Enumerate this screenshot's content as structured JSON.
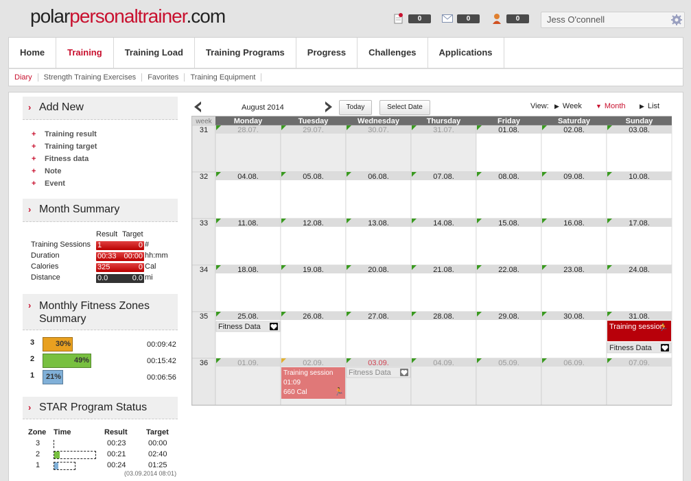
{
  "logo": {
    "part1": "polar",
    "part2": "personaltrainer",
    "part3": ".com"
  },
  "header": {
    "notifications": "0",
    "messages": "0",
    "friends": "0",
    "user": "Jess O'connell"
  },
  "nav": {
    "tabs": [
      "Home",
      "Training",
      "Training Load",
      "Training Programs",
      "Progress",
      "Challenges",
      "Applications"
    ],
    "active": 1
  },
  "subnav": {
    "items": [
      "Diary",
      "Strength Training Exercises",
      "Favorites",
      "Training Equipment"
    ],
    "active": 0
  },
  "add_new": {
    "title": "Add New",
    "items": [
      "Training result",
      "Training target",
      "Fitness data",
      "Note",
      "Event"
    ]
  },
  "month_summary": {
    "title": "Month Summary",
    "col_result": "Result",
    "col_target": "Target",
    "rows": [
      {
        "label": "Training Sessions",
        "result": "1",
        "target": "0",
        "unit": "#",
        "color": "red"
      },
      {
        "label": "Duration",
        "result": "00:33",
        "target": "00:00",
        "unit": "hh:mm",
        "color": "red"
      },
      {
        "label": "Calories",
        "result": "325",
        "target": "0",
        "unit": "Cal",
        "color": "red"
      },
      {
        "label": "Distance",
        "result": "0.0",
        "target": "0.0",
        "unit": "mi",
        "color": "dark"
      }
    ]
  },
  "zones": {
    "title_line1": "Monthly Fitness Zones",
    "title_line2": "Summary",
    "rows": [
      {
        "zone": "3",
        "pct": "30%",
        "pct_value": 30,
        "time": "00:09:42",
        "color": "#e8a020"
      },
      {
        "zone": "2",
        "pct": "49%",
        "pct_value": 49,
        "time": "00:15:42",
        "color": "#78c040"
      },
      {
        "zone": "1",
        "pct": "21%",
        "pct_value": 21,
        "time": "00:06:56",
        "color": "#80b0d8"
      }
    ]
  },
  "star": {
    "title": "STAR Program Status",
    "col_zone": "Zone",
    "col_time": "Time",
    "col_result": "Result",
    "col_target": "Target",
    "rows": [
      {
        "zone": "3",
        "result": "00:23",
        "target": "00:00"
      },
      {
        "zone": "2",
        "result": "00:21",
        "target": "02:40"
      },
      {
        "zone": "1",
        "result": "00:24",
        "target": "01:25"
      }
    ],
    "timestamp": "(03.09.2014 08:01)"
  },
  "calendar": {
    "month_label": "August 2014",
    "today_btn": "Today",
    "select_date_btn": "Select Date",
    "view_label": "View:",
    "views": [
      "Week",
      "Month",
      "List"
    ],
    "active_view": 1,
    "week_header": "week",
    "days": [
      "Monday",
      "Tuesday",
      "Wednesday",
      "Thursday",
      "Friday",
      "Saturday",
      "Sunday"
    ],
    "weeks": [
      {
        "num": "31",
        "dates": [
          "28.07.",
          "29.07.",
          "30.07.",
          "31.07.",
          "01.08.",
          "02.08.",
          "03.08."
        ],
        "out": [
          true,
          true,
          true,
          true,
          false,
          false,
          false
        ]
      },
      {
        "num": "32",
        "dates": [
          "04.08.",
          "05.08.",
          "06.08.",
          "07.08.",
          "08.08.",
          "09.08.",
          "10.08."
        ],
        "out": [
          false,
          false,
          false,
          false,
          false,
          false,
          false
        ]
      },
      {
        "num": "33",
        "dates": [
          "11.08.",
          "12.08.",
          "13.08.",
          "14.08.",
          "15.08.",
          "16.08.",
          "17.08."
        ],
        "out": [
          false,
          false,
          false,
          false,
          false,
          false,
          false
        ]
      },
      {
        "num": "34",
        "dates": [
          "18.08.",
          "19.08.",
          "20.08.",
          "21.08.",
          "22.08.",
          "23.08.",
          "24.08."
        ],
        "out": [
          false,
          false,
          false,
          false,
          false,
          false,
          false
        ]
      },
      {
        "num": "35",
        "dates": [
          "25.08.",
          "26.08.",
          "27.08.",
          "28.08.",
          "29.08.",
          "30.08.",
          "31.08."
        ],
        "out": [
          false,
          false,
          false,
          false,
          false,
          false,
          false
        ]
      },
      {
        "num": "36",
        "dates": [
          "01.09.",
          "02.09.",
          "03.09.",
          "04.09.",
          "05.09.",
          "06.09.",
          "07.09."
        ],
        "out": [
          true,
          true,
          true,
          true,
          true,
          true,
          true
        ]
      }
    ],
    "today_date": "03.09.",
    "events": {
      "fitness_data": "Fitness Data",
      "training_session": "Training session",
      "session_w36_l1": "Training session",
      "session_w36_l2": "01:09",
      "session_w36_l3": "660 Cal"
    }
  },
  "colors": {
    "brand_red": "#c8102e",
    "header_gray": "#6d6d6d"
  }
}
